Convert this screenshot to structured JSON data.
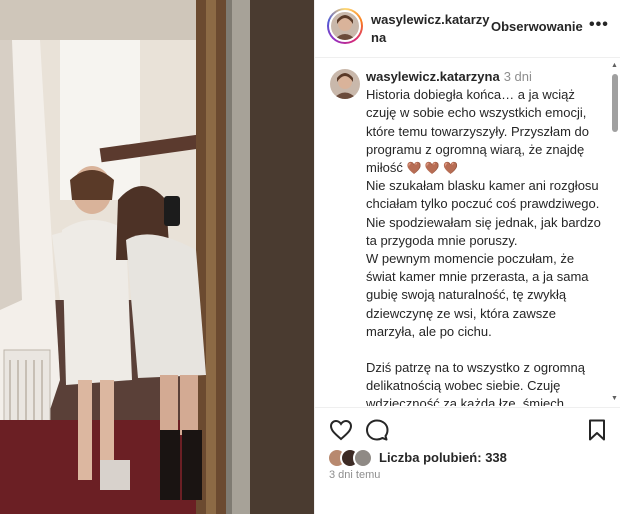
{
  "post": {
    "username": "wasylewicz.katarzyna",
    "follow_label": "Obserwowanie",
    "more_label": "•••"
  },
  "caption": {
    "username": "wasylewicz.katarzyna",
    "time": "3 dni",
    "p1": "Historia dobiegła końca… a ja wciąż czuję w sobie echo wszystkich emocji, które temu towarzyszyły. Przyszłam do programu z ogromną wiarą, że znajdę miłość",
    "hearts": "🤎 🤎 🤎",
    "p2": "Nie szukałam blasku kamer ani rozgłosu chciałam tylko poczuć coś prawdziwego. Nie spodziewałam się jednak, jak bardzo ta przygoda mnie poruszy.",
    "p3": "W pewnym momencie poczułam, że świat kamer mnie przerasta, a ja sama gubię swoją naturalność, tę zwykłą dziewczynę ze wsi, która zawsze marzyła, ale po cichu.",
    "p4": "Dziś patrzę na to wszystko z ogromną delikatnością wobec siebie. Czuję wdzięczność za każdą łzę, śmiech, niepewność i odwagę, które pojawiły się"
  },
  "likes": {
    "label": "Liczba polubień:",
    "count": "338"
  },
  "date": "3 dni temu",
  "icons": [
    "heart-icon",
    "comment-icon",
    "bookmark-icon",
    "more-icon"
  ]
}
